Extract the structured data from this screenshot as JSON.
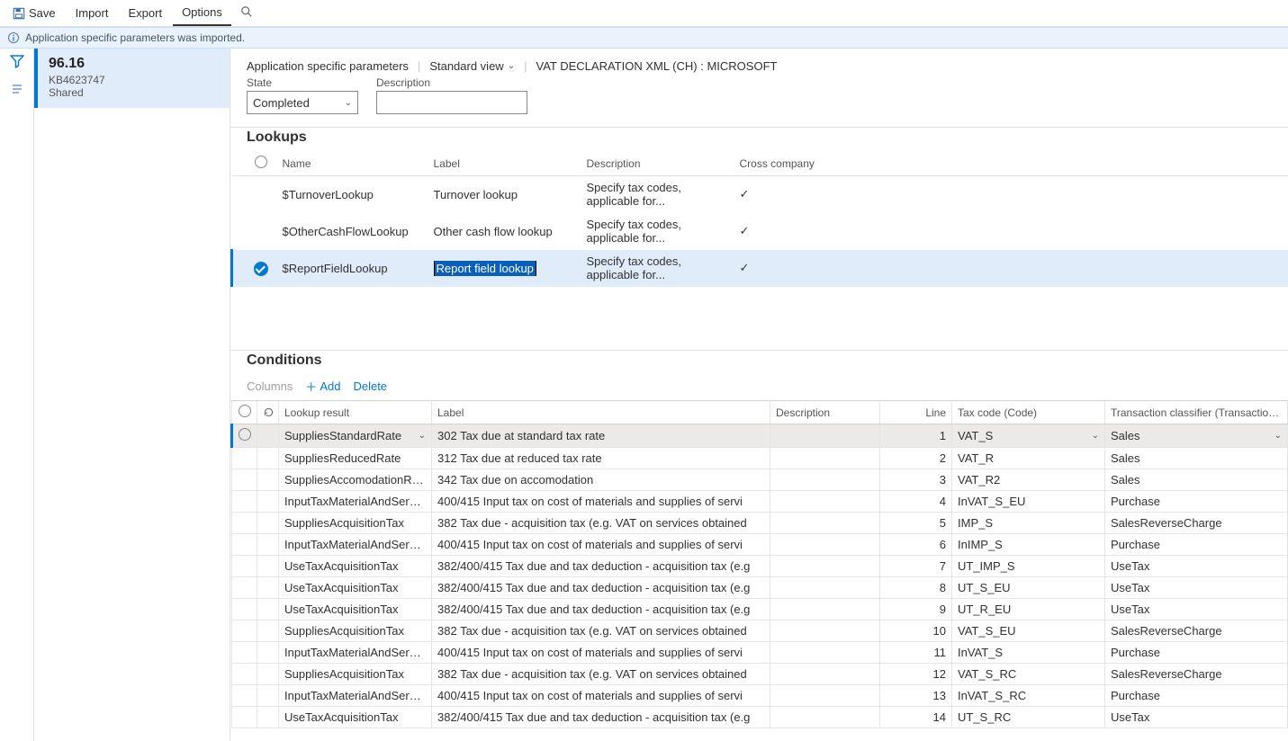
{
  "cmdbar": {
    "save": "Save",
    "import": "Import",
    "export": "Export",
    "options": "Options"
  },
  "info": {
    "msg": "Application specific parameters was imported."
  },
  "version": {
    "number": "96.16",
    "kb": "KB4623747",
    "shared": "Shared"
  },
  "crumb": {
    "asp": "Application specific parameters",
    "view": "Standard view",
    "doc": "VAT DECLARATION XML (CH) : MICROSOFT"
  },
  "form": {
    "state_label": "State",
    "state_value": "Completed",
    "desc_label": "Description",
    "desc_value": ""
  },
  "lookups": {
    "title": "Lookups",
    "headers": {
      "name": "Name",
      "label": "Label",
      "desc": "Description",
      "cross": "Cross company"
    },
    "rows": [
      {
        "name": "$TurnoverLookup",
        "label": "Turnover lookup",
        "desc": "Specify tax codes, applicable for...",
        "cross": true,
        "selected": false
      },
      {
        "name": "$OtherCashFlowLookup",
        "label": "Other cash flow lookup",
        "desc": "Specify tax codes, applicable for...",
        "cross": true,
        "selected": false
      },
      {
        "name": "$ReportFieldLookup",
        "label": "Report field lookup",
        "desc": "Specify tax codes, applicable for...",
        "cross": true,
        "selected": true
      }
    ]
  },
  "conditions": {
    "title": "Conditions",
    "toolbar": {
      "columns": "Columns",
      "add": "Add",
      "del": "Delete"
    },
    "headers": {
      "result": "Lookup result",
      "label": "Label",
      "desc": "Description",
      "line": "Line",
      "tax": "Tax code (Code)",
      "trans": "Transaction classifier (TransactionCla..."
    },
    "rows": [
      {
        "result": "SuppliesStandardRate",
        "label": "302 Tax due at standard tax rate",
        "desc": "",
        "line": 1,
        "tax": "VAT_S",
        "trans": "Sales",
        "selected": true
      },
      {
        "result": "SuppliesReducedRate",
        "label": "312 Tax due at reduced tax rate",
        "desc": "",
        "line": 2,
        "tax": "VAT_R",
        "trans": "Sales"
      },
      {
        "result": "SuppliesAccomodationRate",
        "label": "342 Tax due on accomodation",
        "desc": "",
        "line": 3,
        "tax": "VAT_R2",
        "trans": "Sales"
      },
      {
        "result": "InputTaxMaterialAndServices",
        "label": "400/415 Input tax on cost of materials and supplies of servi",
        "desc": "",
        "line": 4,
        "tax": "InVAT_S_EU",
        "trans": "Purchase"
      },
      {
        "result": "SuppliesAcquisitionTax",
        "label": "382 Tax due - acquisition tax (e.g. VAT on services obtained",
        "desc": "",
        "line": 5,
        "tax": "IMP_S",
        "trans": "SalesReverseCharge"
      },
      {
        "result": "InputTaxMaterialAndServices",
        "label": "400/415 Input tax on cost of materials and supplies of servi",
        "desc": "",
        "line": 6,
        "tax": "InIMP_S",
        "trans": "Purchase"
      },
      {
        "result": "UseTaxAcquisitionTax",
        "label": "382/400/415 Tax due and tax deduction - acquisition tax (e.g",
        "desc": "",
        "line": 7,
        "tax": "UT_IMP_S",
        "trans": "UseTax"
      },
      {
        "result": "UseTaxAcquisitionTax",
        "label": "382/400/415 Tax due and tax deduction - acquisition tax (e.g",
        "desc": "",
        "line": 8,
        "tax": "UT_S_EU",
        "trans": "UseTax"
      },
      {
        "result": "UseTaxAcquisitionTax",
        "label": "382/400/415 Tax due and tax deduction - acquisition tax (e.g",
        "desc": "",
        "line": 9,
        "tax": "UT_R_EU",
        "trans": "UseTax"
      },
      {
        "result": "SuppliesAcquisitionTax",
        "label": "382 Tax due - acquisition tax (e.g. VAT on services obtained",
        "desc": "",
        "line": 10,
        "tax": "VAT_S_EU",
        "trans": "SalesReverseCharge"
      },
      {
        "result": "InputTaxMaterialAndServices",
        "label": "400/415 Input tax on cost of materials and supplies of servi",
        "desc": "",
        "line": 11,
        "tax": "InVAT_S",
        "trans": "Purchase"
      },
      {
        "result": "SuppliesAcquisitionTax",
        "label": "382 Tax due - acquisition tax (e.g. VAT on services obtained",
        "desc": "",
        "line": 12,
        "tax": "VAT_S_RC",
        "trans": "SalesReverseCharge"
      },
      {
        "result": "InputTaxMaterialAndServices",
        "label": "400/415 Input tax on cost of materials and supplies of servi",
        "desc": "",
        "line": 13,
        "tax": "InVAT_S_RC",
        "trans": "Purchase"
      },
      {
        "result": "UseTaxAcquisitionTax",
        "label": "382/400/415 Tax due and tax deduction - acquisition tax (e.g",
        "desc": "",
        "line": 14,
        "tax": "UT_S_RC",
        "trans": "UseTax"
      }
    ]
  }
}
